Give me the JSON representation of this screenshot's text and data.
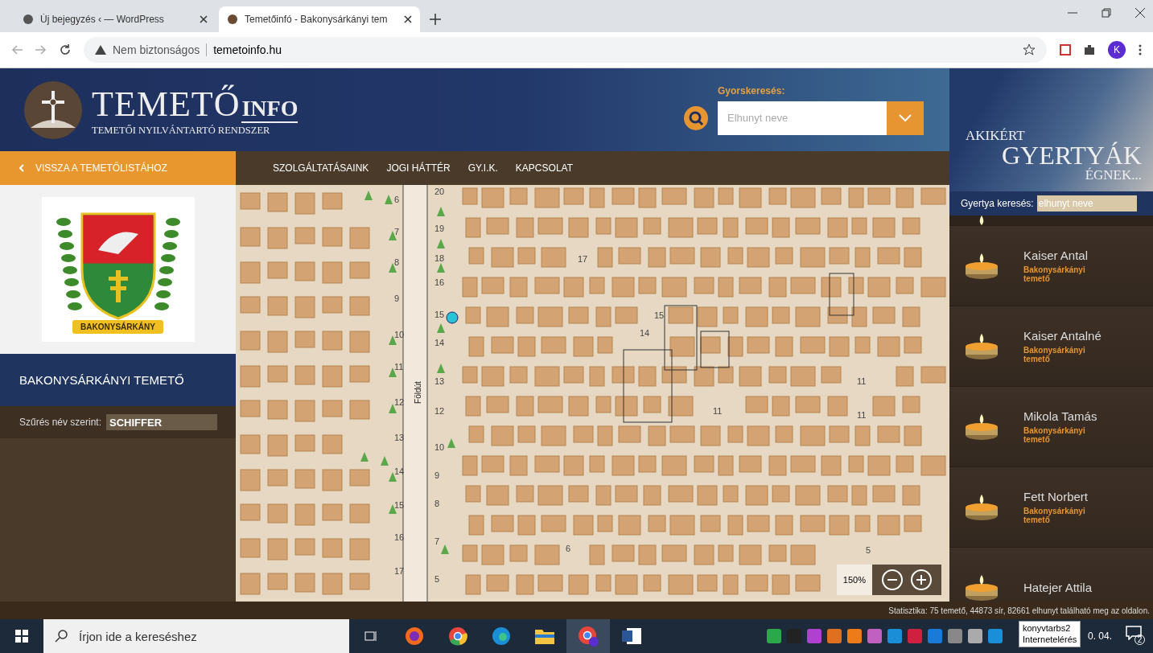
{
  "browser": {
    "tabs": [
      {
        "title": "Új bejegyzés ‹ — WordPress",
        "selected": false
      },
      {
        "title": "Temetőinfó - Bakonysárkányi tem",
        "selected": true
      }
    ],
    "address": {
      "security": "Nem biztonságos",
      "url": "temetoinfo.hu"
    },
    "profile_initial": "K"
  },
  "header": {
    "logo_title": "TEMETŐ",
    "logo_suffix": "INFO",
    "logo_subtitle": "TEMETŐI NYILVÁNTARTÓ RENDSZER",
    "quick_search": {
      "label": "Gyorskeresés:",
      "placeholder": "Elhunyt neve"
    }
  },
  "back_link": "VISSZA A TEMETŐLISTÁHOZ",
  "nav": [
    "SZOLGÁLTATÁSAINK",
    "JOGI HÁTTÉR",
    "GY.I.K.",
    "KAPCSOLAT"
  ],
  "cemetery": {
    "crest_label": "BAKONYSÁRKÁNY",
    "name": "BAKONYSÁRKÁNYI TEMETŐ",
    "filter": {
      "label": "Szűrés név szerint:",
      "value": "SCHIFFER"
    }
  },
  "map": {
    "road_label": "Földút",
    "labels": [
      "20",
      "19",
      "18",
      "16",
      "15",
      "14",
      "13",
      "12",
      "10",
      "9",
      "8",
      "7",
      "5",
      "6",
      "7",
      "8",
      "9",
      "10",
      "11",
      "12",
      "13",
      "14",
      "15",
      "16",
      "17",
      "17",
      "15",
      "14",
      "11",
      "11",
      "11",
      "6",
      "5"
    ],
    "zoom": "150%"
  },
  "candles": {
    "banner": [
      "AKIKÉRT",
      "GYERTYÁK",
      "ÉGNEK..."
    ],
    "search": {
      "label": "Gyertya keresés:",
      "placeholder": "elhunyt neve"
    },
    "items": [
      {
        "name": "Kaiser Antal",
        "cemetery": "Bakonysárkányi temető"
      },
      {
        "name": "Kaiser Antalné",
        "cemetery": "Bakonysárkányi temető"
      },
      {
        "name": "Mikola Tamás",
        "cemetery": "Bakonysárkányi temető"
      },
      {
        "name": "Fett Norbert",
        "cemetery": "Bakonysárkányi temető"
      },
      {
        "name": "Hatejer Attila"
      }
    ]
  },
  "statistics": "Statisztika: 75 temető, 44873 sír, 82661 elhunyt található meg az oldalon.",
  "taskbar": {
    "search_placeholder": "Írjon ide a kereséshez",
    "tooltip": [
      "konyvtarbs2",
      "Internetelérés"
    ],
    "date": "0. 04.",
    "notifications": "2"
  }
}
